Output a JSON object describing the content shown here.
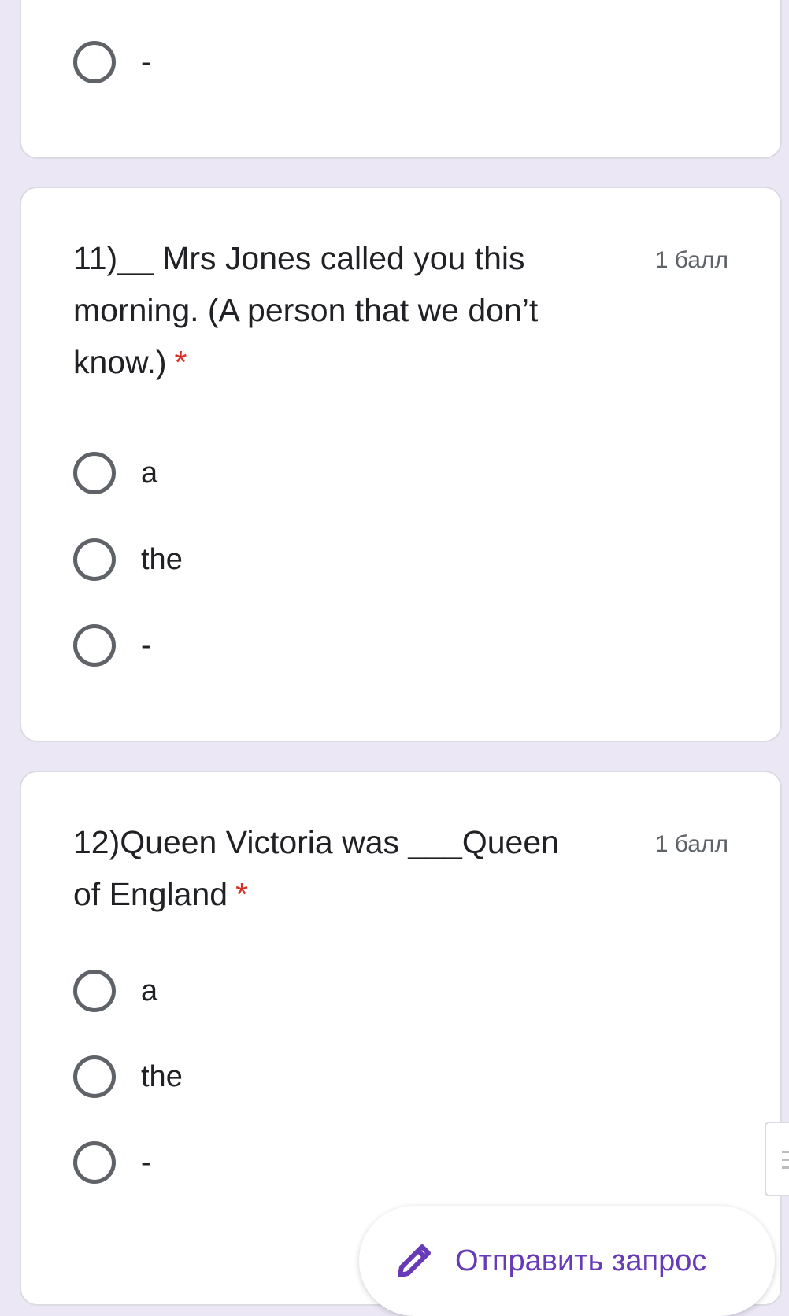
{
  "colors": {
    "page_background": "#ebe7f5",
    "card_background": "#ffffff",
    "required_asterisk": "#d93025",
    "accent": "#673ab7",
    "radio_border": "#5f6368"
  },
  "previous_question": {
    "options": [
      {
        "label": "-"
      }
    ]
  },
  "questions": [
    {
      "title": "11)__ Mrs Jones called you this morning. (A person that we don’t know.)",
      "required_mark": "*",
      "points": "1 балл",
      "options": [
        {
          "label": "a"
        },
        {
          "label": "the"
        },
        {
          "label": "-"
        }
      ]
    },
    {
      "title": "12)Queen Victoria was ___Queen of England",
      "required_mark": "*",
      "points": "1 балл",
      "options": [
        {
          "label": "a"
        },
        {
          "label": "the"
        },
        {
          "label": "-"
        }
      ]
    }
  ],
  "submit_button": {
    "label": "Отправить запрос",
    "icon": "pencil-icon"
  },
  "side_tab": {
    "icon": "menu-lines-icon"
  }
}
